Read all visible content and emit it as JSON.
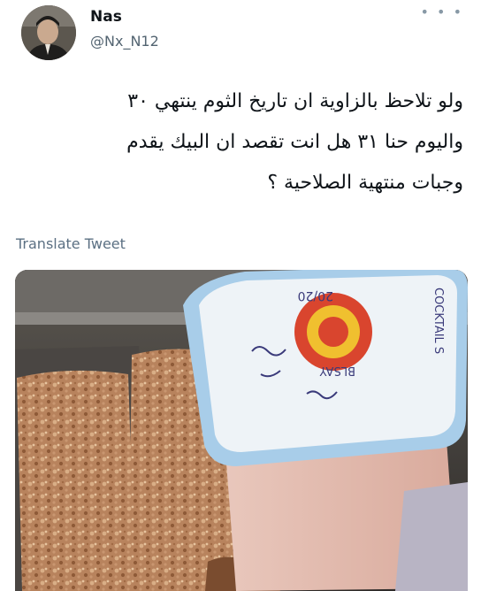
{
  "tweet": {
    "author_name": "Nas",
    "author_handle": "@Nx_N12",
    "more_icon": "ellipsis-icon",
    "text_lines": [
      "ولو تلاحظ بالزاوية ان تاريخ الثوم ينتهي ٣٠",
      "واليوم حنا ٣١ هل انت تقصد ان البيك يقدم",
      "وجبات منتهية الصلاحية ؟"
    ],
    "translate_label": "Translate Tweet"
  },
  "photo": {
    "cup_lid_text": "COCKTAIL S",
    "cup_date_text": "20/20",
    "cup_code_text": "BLSAY"
  },
  "colors": {
    "handle_gray": "#536471",
    "lid_blue": "#a8cde9",
    "cup_pink": "#e8c4ba"
  }
}
